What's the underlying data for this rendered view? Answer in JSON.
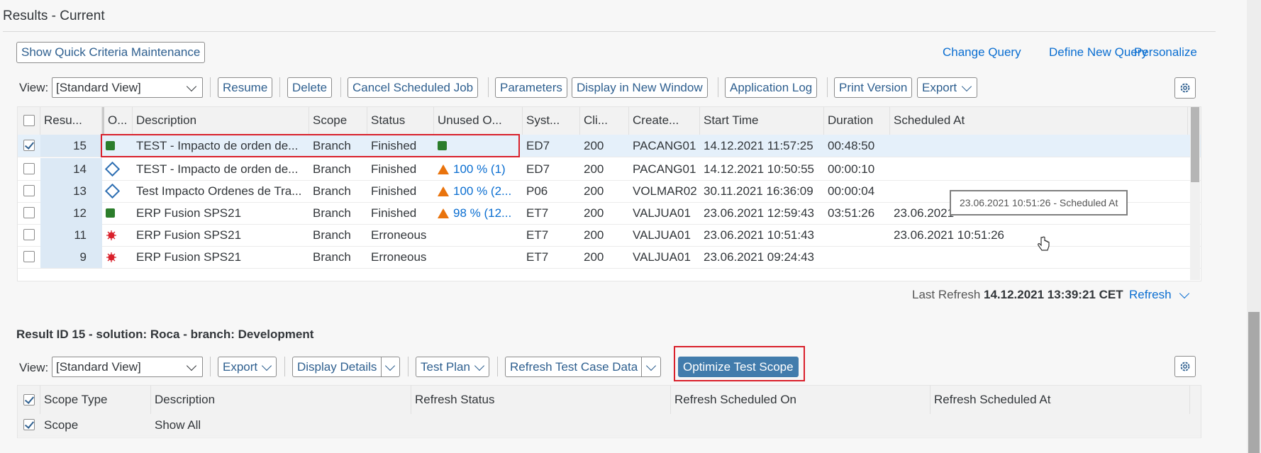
{
  "page": {
    "title": "Results - Current"
  },
  "top": {
    "quick_criteria": "Show Quick Criteria Maintenance",
    "links": [
      "Change Query",
      "Define New Query",
      "Personalize"
    ]
  },
  "toolbar1": {
    "view_label": "View:",
    "view_value": "[Standard View]",
    "buttons": [
      "Resume",
      "Delete",
      "Cancel Scheduled Job",
      "Parameters",
      "Display in New Window",
      "Application Log",
      "Print Version"
    ],
    "export": "Export"
  },
  "results_table": {
    "columns": [
      "Resu...",
      "O...",
      "Description",
      "Scope",
      "Status",
      "Unused O...",
      "Syst...",
      "Cli...",
      "Create...",
      "Start Time",
      "Duration",
      "Scheduled At"
    ],
    "rows": [
      {
        "id": "15",
        "overall": "green",
        "description": "TEST - Impacto de orden de...",
        "scope": "Branch",
        "status": "Finished",
        "unused": "",
        "unused_icon": "green",
        "system": "ED7",
        "client": "200",
        "created_by": "PACANG01",
        "start": "14.12.2021 11:57:25",
        "duration": "00:48:50",
        "scheduled": "",
        "selected": true
      },
      {
        "id": "14",
        "overall": "diamond",
        "description": "TEST - Impacto de orden de...",
        "scope": "Branch",
        "status": "Finished",
        "unused": "100 % (1)",
        "unused_icon": "warning",
        "system": "ED7",
        "client": "200",
        "created_by": "PACANG01",
        "start": "14.12.2021 10:50:55",
        "duration": "00:00:10",
        "scheduled": "",
        "selected": false
      },
      {
        "id": "13",
        "overall": "diamond",
        "description": "Test Impacto Ordenes de Tra...",
        "scope": "Branch",
        "status": "Finished",
        "unused": "100 % (2...",
        "unused_icon": "warning",
        "system": "P06",
        "client": "200",
        "created_by": "VOLMAR02",
        "start": "30.11.2021 16:36:09",
        "duration": "00:00:04",
        "scheduled": "",
        "selected": false
      },
      {
        "id": "12",
        "overall": "green",
        "description": "ERP Fusion SPS21",
        "scope": "Branch",
        "status": "Finished",
        "unused": "98 % (12...",
        "unused_icon": "warning",
        "system": "ET7",
        "client": "200",
        "created_by": "VALJUA01",
        "start": "23.06.2021 12:59:43",
        "duration": "03:51:26",
        "scheduled": "23.06.2021",
        "selected": false
      },
      {
        "id": "11",
        "overall": "error",
        "description": "ERP Fusion SPS21",
        "scope": "Branch",
        "status": "Erroneous",
        "unused": "",
        "unused_icon": "",
        "system": "ET7",
        "client": "200",
        "created_by": "VALJUA01",
        "start": "23.06.2021 10:51:43",
        "duration": "",
        "scheduled": "23.06.2021 10:51:26",
        "selected": false
      },
      {
        "id": "9",
        "overall": "error",
        "description": "ERP Fusion SPS21",
        "scope": "Branch",
        "status": "Erroneous",
        "unused": "",
        "unused_icon": "",
        "system": "ET7",
        "client": "200",
        "created_by": "VALJUA01",
        "start": "23.06.2021 09:24:43",
        "duration": "",
        "scheduled": "",
        "selected": false
      }
    ]
  },
  "tooltip": "23.06.2021 10:51:26 - Scheduled At",
  "refresh": {
    "label": "Last Refresh",
    "value": "14.12.2021 13:39:21 CET",
    "link": "Refresh"
  },
  "detail": {
    "title": "Result ID 15 - solution: Roca - branch: Development",
    "view_label": "View:",
    "view_value": "[Standard View]",
    "export": "Export",
    "display_details": "Display Details",
    "test_plan": "Test Plan",
    "refresh_test_case_data": "Refresh Test Case Data",
    "optimize": "Optimize Test Scope",
    "columns": [
      "Scope Type",
      "Description",
      "Refresh Status",
      "Refresh Scheduled On",
      "Refresh Scheduled At"
    ],
    "rows": [
      {
        "scope_type": "Scope",
        "description": "Show All",
        "refresh_status": "",
        "scheduled_on": "",
        "scheduled_at": ""
      }
    ]
  },
  "colors": {
    "accent": "#0a6ed1",
    "button_text": "#2e5f8f",
    "primary_button": "#427cac",
    "highlight": "#d9202b"
  }
}
